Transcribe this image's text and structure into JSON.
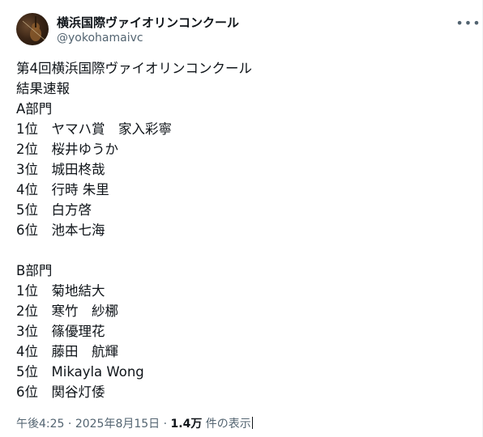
{
  "author": {
    "display_name": "横浜国際ヴァイオリンコンクール",
    "handle": "@yokohamaivc"
  },
  "menu_icon": "more-horizontal-icon",
  "tweet_lines": [
    "第4回横浜国際ヴァイオリンコンクール",
    "結果速報",
    "A部門",
    "1位　ヤマハ賞　家入彩寧",
    "2位　桜井ゆうか",
    "3位　城田柊哉",
    "4位　行時 朱里",
    "5位　白方啓",
    "6位　池本七海",
    "",
    "B部門",
    "1位　菊地結大",
    "2位　寒竹　紗梛",
    "3位　篠優理花",
    "4位　藤田　航輝",
    "5位　Mikayla Wong",
    "6位　関谷灯倭"
  ],
  "meta": {
    "time": "午後4:25",
    "date": "2025年8月15日",
    "separator": "·",
    "view_count": "1.4万",
    "view_label": "件の表示"
  }
}
